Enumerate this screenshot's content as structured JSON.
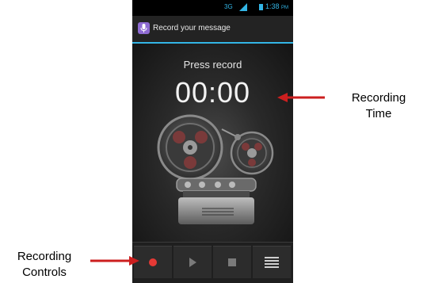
{
  "status_bar": {
    "network": "3G",
    "time": "1:38",
    "time_suffix": "PM",
    "accent_color": "#33b5e5"
  },
  "action_bar": {
    "title": "Record your message",
    "icon": "microphone-icon"
  },
  "recorder": {
    "status_text": "Press record",
    "elapsed_time": "00:00",
    "illustration": "reel-to-reel-tape-recorder"
  },
  "controls": {
    "record_icon": "record-icon",
    "play_icon": "play-icon",
    "stop_icon": "stop-icon",
    "list_icon": "list-icon",
    "record_color": "#e53935"
  },
  "annotations": {
    "time_line1": "Recording",
    "time_line2": "Time",
    "controls_line1": "Recording",
    "controls_line2": "Controls",
    "arrow_color": "#cc1f1f"
  }
}
